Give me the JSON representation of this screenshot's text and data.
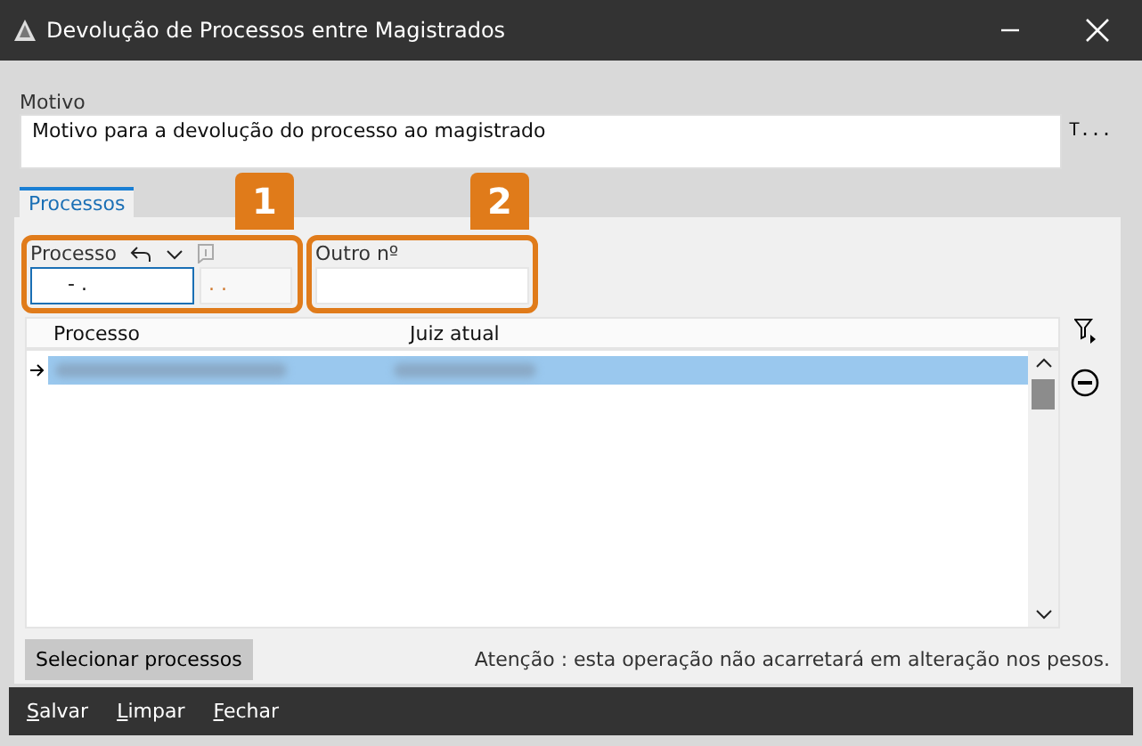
{
  "window": {
    "title": "Devolução de Processos entre Magistrados"
  },
  "motivo": {
    "label": "Motivo",
    "value": "Motivo para a devolução do processo ao magistrado",
    "side_label": "T..."
  },
  "tabs": [
    {
      "label": "Processos",
      "selected": true
    }
  ],
  "callouts": [
    "1",
    "2"
  ],
  "processo_field": {
    "label": "Processo",
    "value": "- .",
    "value_2": ". ."
  },
  "outro_field": {
    "label": "Outro nº"
  },
  "table": {
    "columns": [
      "Processo",
      "Juiz atual"
    ],
    "rows": [
      {
        "selected": true
      }
    ]
  },
  "select_button": "Selecionar processos",
  "notice": "Atenção : esta operação não acarretará em alteração nos pesos.",
  "footer_buttons": [
    "Salvar",
    "Limpar",
    "Fechar"
  ]
}
